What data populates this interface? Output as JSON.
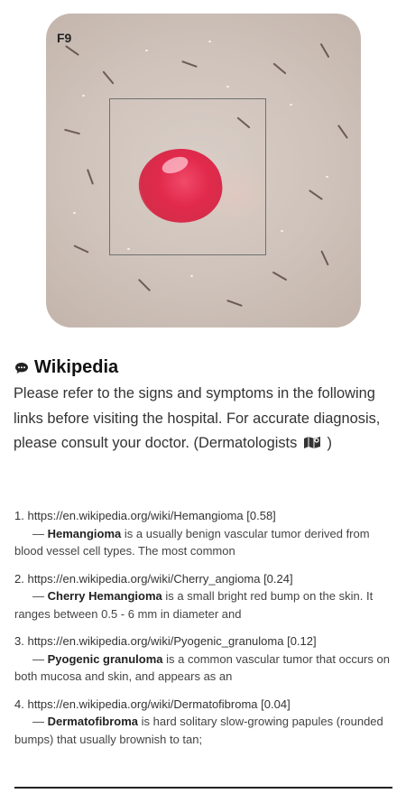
{
  "image": {
    "label": "F9"
  },
  "wiki": {
    "title": "Wikipedia",
    "intro_main": "Please refer to the signs and symptoms in the following links before visiting the hospital. For accurate diagnosis, please consult your doctor. (Dermatologists",
    "intro_end": ")"
  },
  "references": [
    {
      "index": "1.",
      "url": "https://en.wikipedia.org/wiki/Hemangioma",
      "score": "[0.58]",
      "dash": "—",
      "term": "Hemangioma",
      "text": "is a usually benign vascular tumor derived from blood vessel cell types. The most common"
    },
    {
      "index": "2.",
      "url": "https://en.wikipedia.org/wiki/Cherry_angioma",
      "score": "[0.24]",
      "dash": "—",
      "term": "Cherry Hemangioma",
      "text": "is a small bright red bump on the skin. It ranges between 0.5 - 6 mm in diameter and"
    },
    {
      "index": "3.",
      "url": "https://en.wikipedia.org/wiki/Pyogenic_granuloma",
      "score": "[0.12]",
      "dash": "—",
      "term": "Pyogenic granuloma",
      "text": "is a common vascular tumor that occurs on both mucosa and skin, and appears as an"
    },
    {
      "index": "4.",
      "url": "https://en.wikipedia.org/wiki/Dermatofibroma",
      "score": "[0.04]",
      "dash": "—",
      "term": "Dermatofibroma",
      "text": "is hard solitary slow-growing papules (rounded bumps) that usually brownish to tan;"
    }
  ]
}
